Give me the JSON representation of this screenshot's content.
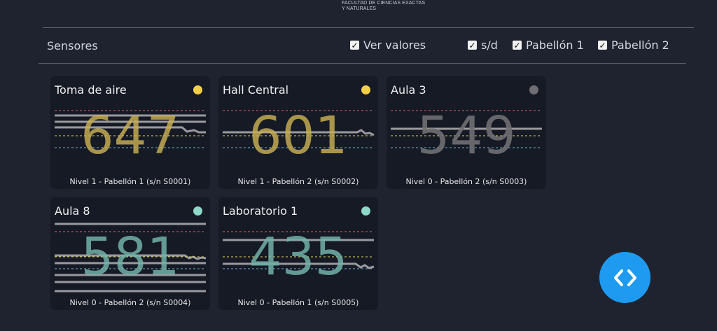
{
  "header": {
    "brand_line1": "FACULTAD DE CIENCIAS EXACTAS",
    "brand_line2": "Y NATURALES"
  },
  "toolbar": {
    "title": "Sensores",
    "checks": [
      {
        "label": "Ver valores",
        "checked": true
      },
      {
        "label": "s/d",
        "checked": true
      },
      {
        "label": "Pabellón 1",
        "checked": true
      },
      {
        "label": "Pabellón 2",
        "checked": true
      }
    ]
  },
  "sensors": [
    {
      "name": "Toma de aire",
      "value": "647",
      "color": "#c8b054",
      "dot": "#f2cf4a",
      "location": "Nivel 1 - Pabellón 1 (s/n S0001)"
    },
    {
      "name": "Hall Central",
      "value": "601",
      "color": "#c8b054",
      "dot": "#f2cf4a",
      "location": "Nivel 1 - Pabellón 2 (s/n S0002)"
    },
    {
      "name": "Aula 3",
      "value": "549",
      "color": "#6f6f73",
      "dot": "#6f6f73",
      "location": "Nivel 0 - Pabellón 2 (s/n S0003)"
    },
    {
      "name": "Aula 8",
      "value": "581",
      "color": "#72b2a8",
      "dot": "#8ed8c9",
      "location": "Nivel 0 - Pabellón 2 (s/n S0004)"
    },
    {
      "name": "Laboratorio 1",
      "value": "435",
      "color": "#72b2a8",
      "dot": "#8ed8c9",
      "location": "Nivel 0 - Pabellón 1 (s/n S0005)"
    }
  ],
  "colors": {
    "threshold_high": "#d9626e",
    "threshold_mid": "#e6d45a",
    "threshold_low": "#6fb6d9",
    "fab": "#1e9bf0"
  },
  "fab": {
    "icon": "code-icon"
  }
}
